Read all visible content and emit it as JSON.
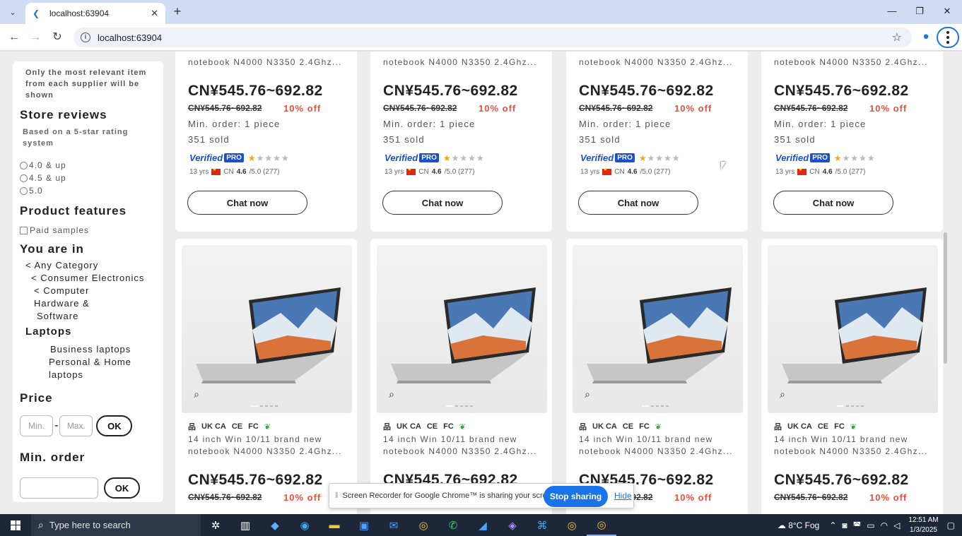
{
  "browser": {
    "tab_title": "localhost:63904",
    "url": "localhost:63904"
  },
  "sidebar": {
    "note": "Only the most relevant item from each supplier will be shown",
    "store_reviews_title": "Store reviews",
    "store_reviews_sub": "Based on a 5-star rating system",
    "ratings": [
      "4.0 & up",
      "4.5 & up",
      "5.0"
    ],
    "features_title": "Product features",
    "paid_samples": "Paid samples",
    "you_are_in_title": "You are in",
    "breadcrumb": [
      "< Any Category",
      "< Consumer Electronics",
      "< Computer",
      "Hardware &",
      "Software"
    ],
    "current_category": "Laptops",
    "subcategories": [
      "Business laptops",
      "Personal & Home",
      "laptops"
    ],
    "price_title": "Price",
    "min_placeholder": "Min.",
    "max_placeholder": "Max.",
    "ok_label": "OK",
    "min_order_title": "Min. order"
  },
  "product": {
    "name_line1": "14 inch Win 10/11 brand new",
    "name_line2": "notebook N4000 N3350 2.4Ghz...",
    "price": "CN¥545.76~692.82",
    "old_price": "CN¥545.76~692.82",
    "discount": "10% off",
    "min_order": "Min. order: 1 piece",
    "sold": "351 sold",
    "verified": "Verified",
    "pro": "PRO",
    "rating_stars": 1,
    "years": "13 yrs",
    "country": "CN",
    "score": "4.6",
    "score_suffix": "/5.0 (277)",
    "chat_label": "Chat now",
    "cert_labels": [
      "UK CA",
      "CE",
      "FC"
    ]
  },
  "share_bar": {
    "message": "Screen Recorder for Google Chrome™ is sharing your screen.",
    "stop_label": "Stop sharing",
    "hide_label": "Hide"
  },
  "taskbar": {
    "search_placeholder": "Type here to search",
    "weather": "8°C  Fog",
    "time": "12:51 AM",
    "date": "1/3/2025"
  },
  "colors": {
    "accent": "#1a73e8",
    "discount": "#f04d3a",
    "verified": "#1a4fd0",
    "star": "#f2a900"
  }
}
